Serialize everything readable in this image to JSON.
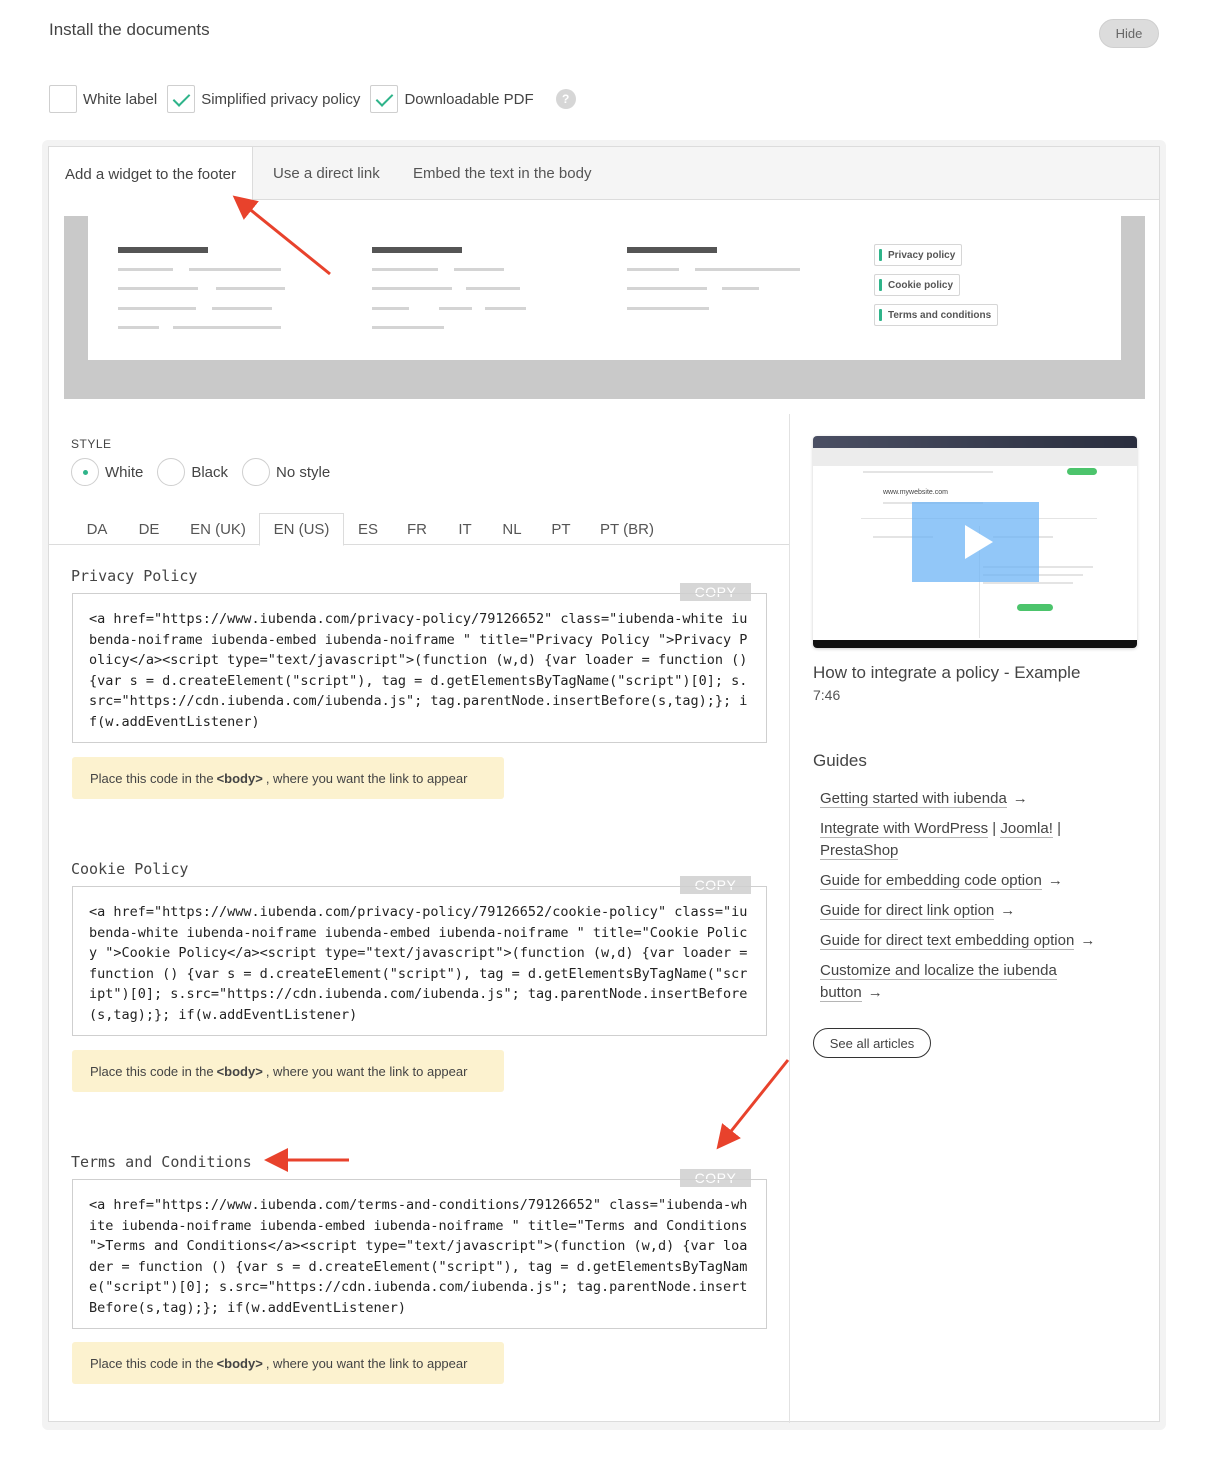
{
  "header": {
    "title": "Install the documents",
    "hide_label": "Hide"
  },
  "options": [
    {
      "label": "White label",
      "checked": false
    },
    {
      "label": "Simplified privacy policy",
      "checked": true
    },
    {
      "label": "Downloadable PDF",
      "checked": true
    }
  ],
  "help_glyph": "?",
  "tabs": [
    {
      "label": "Add a widget to the footer",
      "active": true
    },
    {
      "label": "Use a direct link",
      "active": false
    },
    {
      "label": "Embed the text in the body",
      "active": false
    }
  ],
  "preview": {
    "buttons": [
      "Privacy policy",
      "Cookie policy",
      "Terms and conditions"
    ]
  },
  "style": {
    "label": "STYLE",
    "options": [
      {
        "label": "White",
        "selected": true
      },
      {
        "label": "Black",
        "selected": false
      },
      {
        "label": "No style",
        "selected": false
      }
    ]
  },
  "languages": [
    "DA",
    "DE",
    "EN (UK)",
    "EN (US)",
    "ES",
    "FR",
    "IT",
    "NL",
    "PT",
    "PT (BR)"
  ],
  "active_language": "EN (US)",
  "sections": [
    {
      "title": "Privacy Policy",
      "copy_label": "COPY",
      "code": "<a href=\"https://www.iubenda.com/privacy-policy/79126652\" class=\"iubenda-white iubenda-noiframe iubenda-embed iubenda-noiframe \" title=\"Privacy Policy \">Privacy Policy</a><script type=\"text/javascript\">(function (w,d) {var loader = function () {var s = d.createElement(\"script\"), tag = d.getElementsByTagName(\"script\")[0]; s.src=\"https://cdn.iubenda.com/iubenda.js\"; tag.parentNode.insertBefore(s,tag);}; if(w.addEventListener)",
      "note_prefix": "Place this code in the",
      "note_tag": "<body>",
      "note_suffix": ", where you want the link to appear"
    },
    {
      "title": "Cookie Policy",
      "copy_label": "COPY",
      "code": "<a href=\"https://www.iubenda.com/privacy-policy/79126652/cookie-policy\" class=\"iubenda-white iubenda-noiframe iubenda-embed iubenda-noiframe \" title=\"Cookie Policy \">Cookie Policy</a><script type=\"text/javascript\">(function (w,d) {var loader = function () {var s = d.createElement(\"script\"), tag = d.getElementsByTagName(\"script\")[0]; s.src=\"https://cdn.iubenda.com/iubenda.js\"; tag.parentNode.insertBefore(s,tag);}; if(w.addEventListener)",
      "note_prefix": "Place this code in the",
      "note_tag": "<body>",
      "note_suffix": ", where you want the link to appear"
    },
    {
      "title": "Terms and Conditions",
      "copy_label": "COPY",
      "code": "<a href=\"https://www.iubenda.com/terms-and-conditions/79126652\" class=\"iubenda-white iubenda-noiframe iubenda-embed iubenda-noiframe \" title=\"Terms and Conditions \">Terms and Conditions</a><script type=\"text/javascript\">(function (w,d) {var loader = function () {var s = d.createElement(\"script\"), tag = d.getElementsByTagName(\"script\")[0]; s.src=\"https://cdn.iubenda.com/iubenda.js\"; tag.parentNode.insertBefore(s,tag);}; if(w.addEventListener)",
      "note_prefix": "Place this code in the",
      "note_tag": "<body>",
      "note_suffix": ", where you want the link to appear"
    }
  ],
  "video": {
    "title": "How to integrate a policy - Example",
    "duration": "7:46",
    "thumb_url_text": "www.mywebsite.com"
  },
  "guides": {
    "title": "Guides",
    "items": [
      {
        "parts": [
          "Getting started with iubenda"
        ],
        "arrow": true
      },
      {
        "parts": [
          "Integrate with WordPress",
          "Joomla!",
          "PrestaShop"
        ],
        "separator": " | ",
        "arrow": false
      },
      {
        "parts": [
          "Guide for embedding code option"
        ],
        "arrow": true
      },
      {
        "parts": [
          "Guide for direct link option"
        ],
        "arrow": true
      },
      {
        "parts": [
          "Guide for direct text embedding option"
        ],
        "arrow": true
      },
      {
        "parts": [
          "Customize and localize the iubenda button"
        ],
        "arrow": true
      }
    ],
    "see_all": "See all articles"
  },
  "colors": {
    "accent": "#2fb48a",
    "note_bg": "#fcf2cf",
    "annotation": "#e8422c"
  }
}
